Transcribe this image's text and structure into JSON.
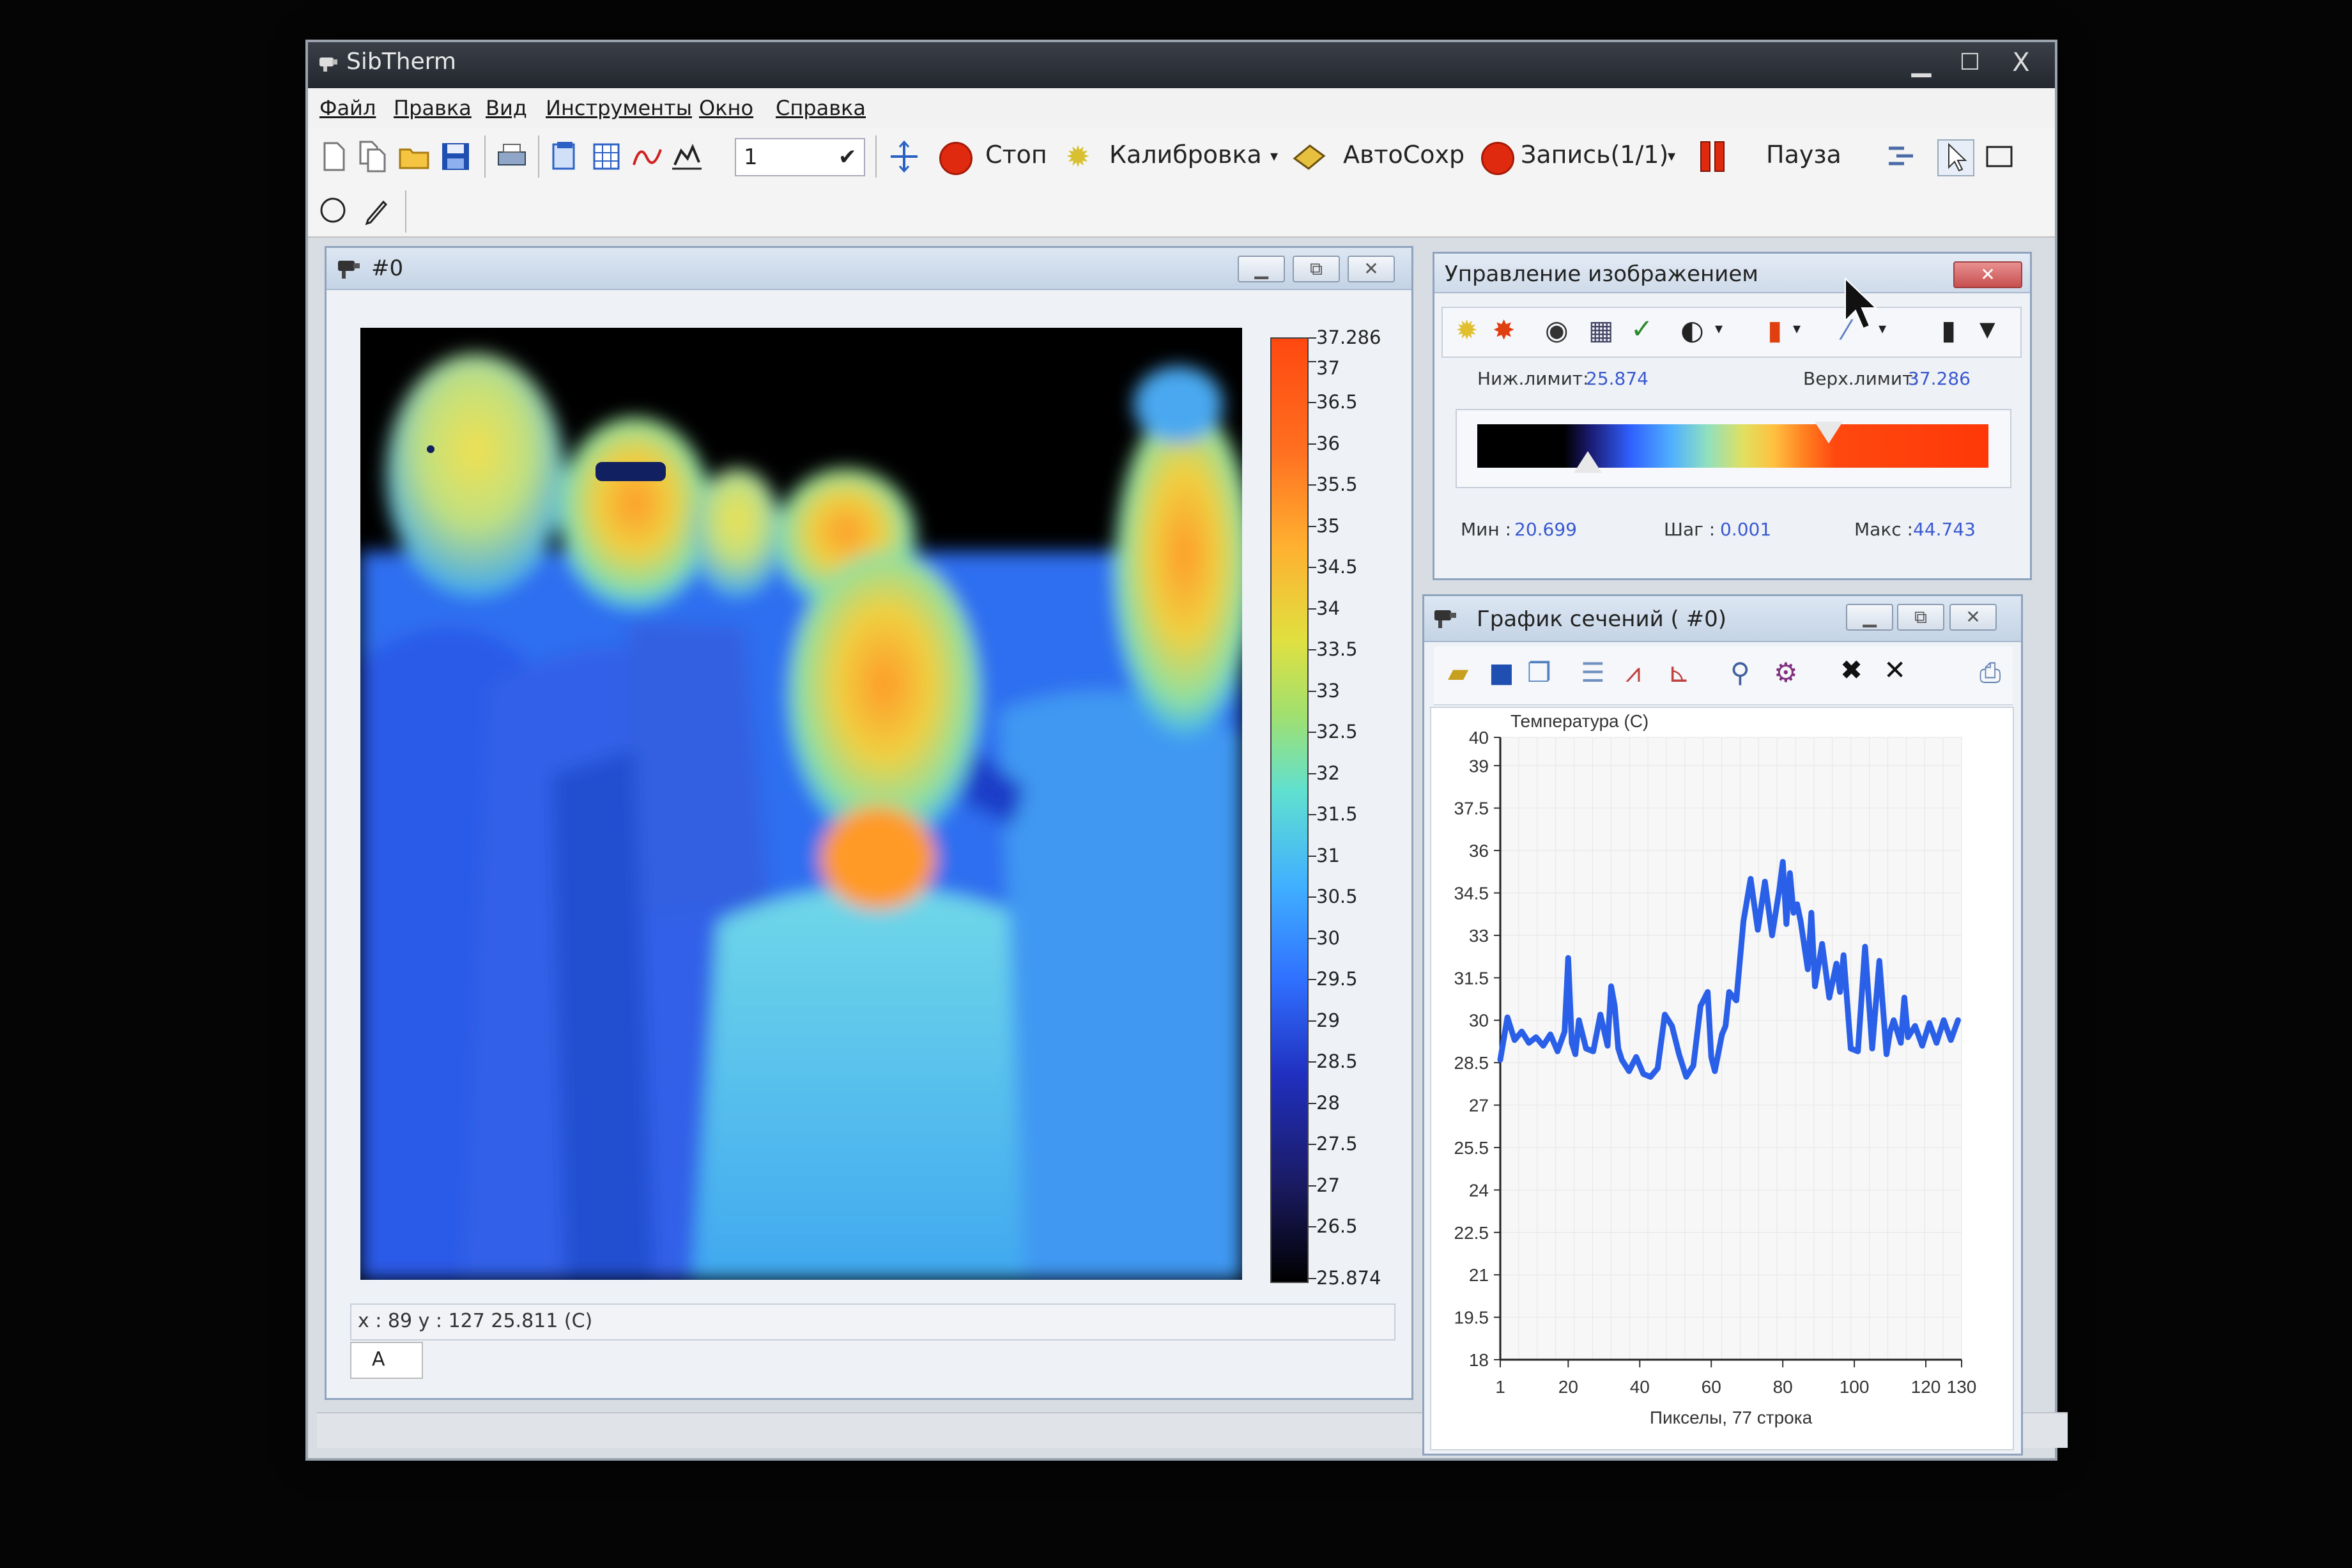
{
  "window": {
    "title": "SibTherm",
    "min": "▁",
    "max": "☐",
    "close": "X"
  },
  "menu": [
    "Файл",
    "Правка",
    "Вид",
    "Инструменты",
    "Окно",
    "Справка"
  ],
  "toolbar": {
    "frame_value": "1",
    "stop_label": "Стоп",
    "calibration_label": "Калибровка",
    "autosave_label": "АвтоСохр",
    "record_label": "Запись(1/1)",
    "pause_label": "Пауза"
  },
  "thermal_window": {
    "title": "#0",
    "scale_ticks": [
      "37.286",
      "37",
      "36.5",
      "36",
      "35.5",
      "35",
      "34.5",
      "34",
      "33.5",
      "33",
      "32.5",
      "32",
      "31.5",
      "31",
      "30.5",
      "30",
      "29.5",
      "29",
      "28.5",
      "28",
      "27.5",
      "27",
      "26.5",
      "25.874"
    ],
    "status": "x : 89 y : 127   25.811 (C)",
    "tab": "A"
  },
  "image_control": {
    "title": "Управление изображением",
    "lower_label": "Ниж.лимит:",
    "lower_value": "25.874",
    "upper_label": "Верх.лимит:",
    "upper_value": "37.286",
    "min_label": "Мин :",
    "min_value": "20.699",
    "step_label": "Шаг :",
    "step_value": "0.001",
    "max_label": "Макс :",
    "max_value": "44.743",
    "lower_fraction": 0.216,
    "upper_fraction": 0.688
  },
  "chart_window": {
    "title": "График сечений ( #0)"
  },
  "chart_data": {
    "type": "line",
    "ylabel": "Температура (C)",
    "xlabel": "Пикселы, 77 строка",
    "xlim": [
      1,
      130
    ],
    "ylim": [
      18,
      40
    ],
    "x_ticks": [
      "1",
      "20",
      "40",
      "60",
      "80",
      "100",
      "120",
      "130"
    ],
    "y_ticks": [
      "40",
      "39",
      "37.5",
      "36",
      "34.5",
      "33",
      "31.5",
      "30",
      "28.5",
      "27",
      "25.5",
      "24",
      "22.5",
      "21",
      "19.5",
      "18"
    ],
    "series": [
      {
        "color": "#2a5fe8",
        "x": [
          1,
          3,
          5,
          7,
          9,
          11,
          13,
          15,
          17,
          19,
          20,
          21,
          22,
          23,
          25,
          27,
          29,
          31,
          32,
          33,
          34,
          35,
          37,
          39,
          41,
          43,
          45,
          47,
          49,
          51,
          53,
          55,
          57,
          59,
          60,
          61,
          63,
          64,
          65,
          67,
          69,
          71,
          73,
          75,
          77,
          79,
          80,
          81,
          82,
          83,
          84,
          85,
          87,
          88,
          89,
          91,
          93,
          95,
          96,
          97,
          99,
          101,
          103,
          105,
          107,
          109,
          110,
          111,
          113,
          114,
          115,
          117,
          119,
          121,
          123,
          125,
          127,
          129
        ],
        "y": [
          28.6,
          30.1,
          29.3,
          29.6,
          29.2,
          29.4,
          29.1,
          29.5,
          28.9,
          29.6,
          32.2,
          29.2,
          28.8,
          30.0,
          29.0,
          28.9,
          30.2,
          29.1,
          31.2,
          30.5,
          29.0,
          28.6,
          28.2,
          28.7,
          28.1,
          28.0,
          28.3,
          30.2,
          29.8,
          28.8,
          28.0,
          28.4,
          30.5,
          31.0,
          28.7,
          28.2,
          29.5,
          29.8,
          31.0,
          30.7,
          33.5,
          35.0,
          33.2,
          34.9,
          33.0,
          34.6,
          35.6,
          33.4,
          35.2,
          33.8,
          34.1,
          33.5,
          31.8,
          33.8,
          31.2,
          32.7,
          30.8,
          32.0,
          31.0,
          32.3,
          29.0,
          28.9,
          32.6,
          29.0,
          32.1,
          28.8,
          29.6,
          30.0,
          29.2,
          30.8,
          29.4,
          29.8,
          29.1,
          29.9,
          29.2,
          30.0,
          29.3,
          30.0
        ]
      }
    ]
  }
}
